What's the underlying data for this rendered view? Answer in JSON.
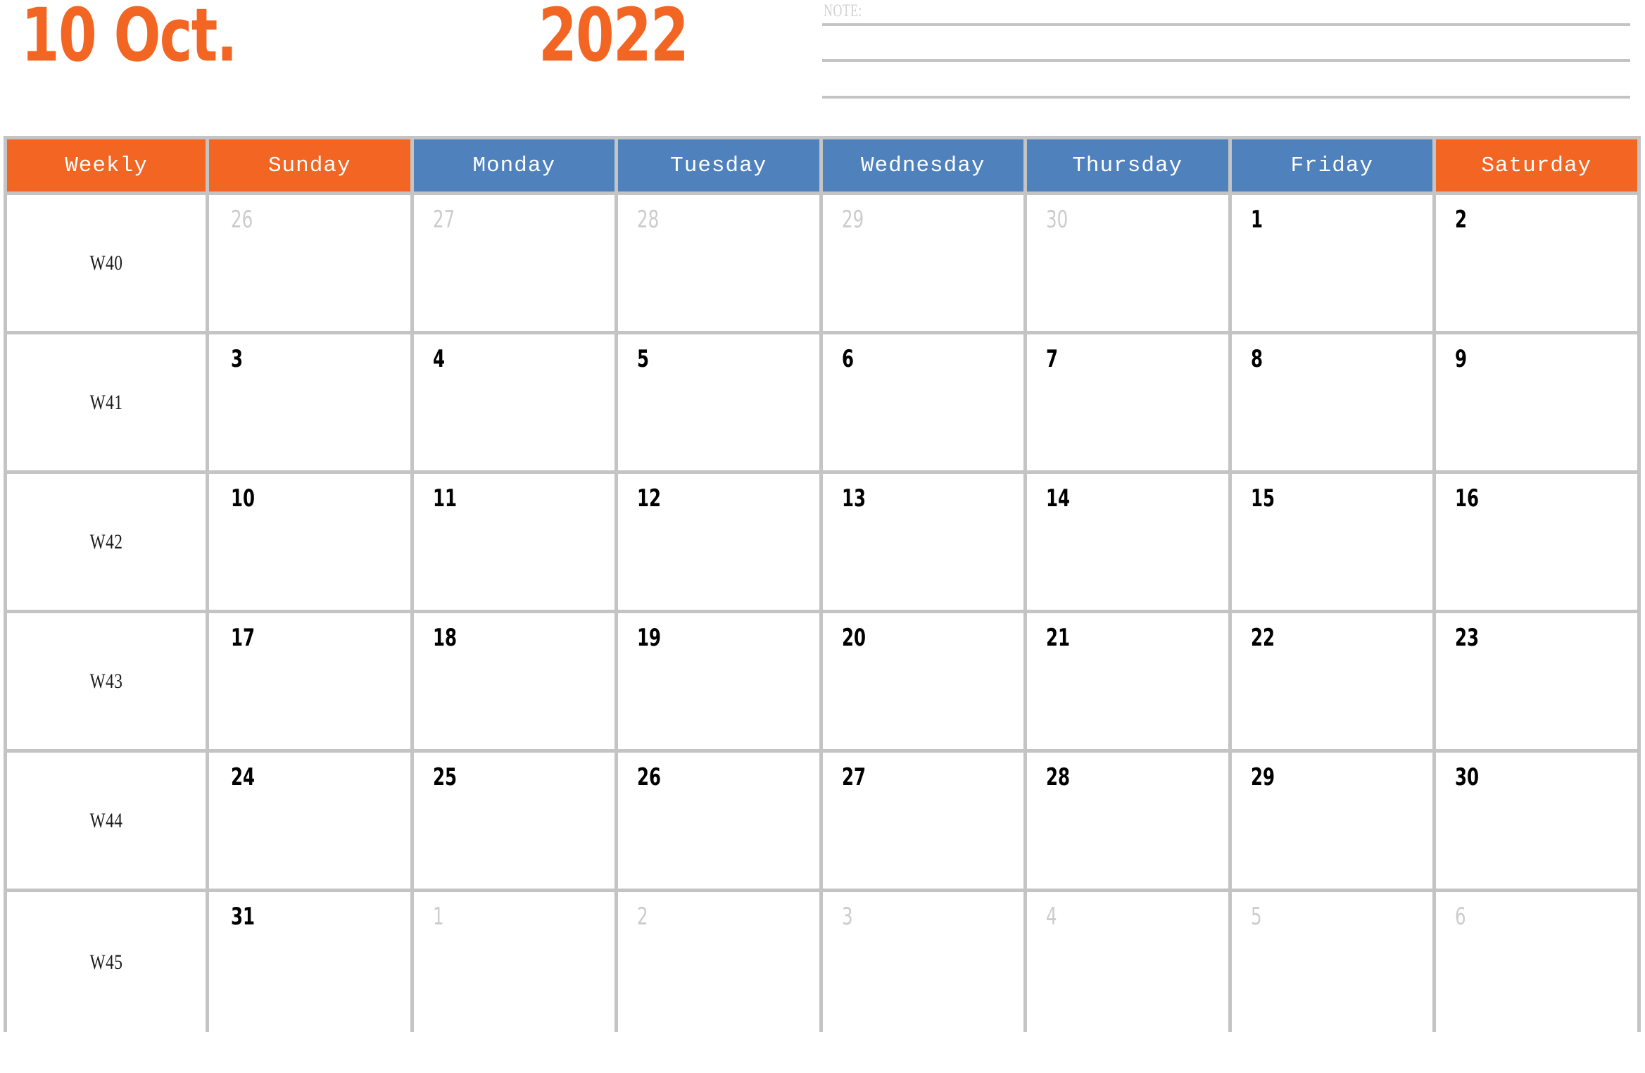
{
  "header": {
    "month_label": "10 Oct.",
    "year_label": "2022",
    "accent_orange": "#F26522",
    "accent_blue": "#4F81BD",
    "grid_line_color": "#C4C4C4",
    "muted_text_color": "#CCCCCC"
  },
  "note": {
    "label": "NOTE:",
    "lines": [
      "",
      "",
      ""
    ]
  },
  "calendar": {
    "columns": [
      {
        "label": "Weekly",
        "style": "orange"
      },
      {
        "label": "Sunday",
        "style": "orange"
      },
      {
        "label": "Monday",
        "style": "blue"
      },
      {
        "label": "Tuesday",
        "style": "blue"
      },
      {
        "label": "Wednesday",
        "style": "blue"
      },
      {
        "label": "Thursday",
        "style": "blue"
      },
      {
        "label": "Friday",
        "style": "blue"
      },
      {
        "label": "Saturday",
        "style": "orange"
      }
    ],
    "weeks": [
      {
        "week_label": "W40",
        "days": [
          {
            "num": "26",
            "muted": true
          },
          {
            "num": "27",
            "muted": true
          },
          {
            "num": "28",
            "muted": true
          },
          {
            "num": "29",
            "muted": true
          },
          {
            "num": "30",
            "muted": true
          },
          {
            "num": "1",
            "muted": false
          },
          {
            "num": "2",
            "muted": false
          }
        ]
      },
      {
        "week_label": "W41",
        "days": [
          {
            "num": "3",
            "muted": false
          },
          {
            "num": "4",
            "muted": false
          },
          {
            "num": "5",
            "muted": false
          },
          {
            "num": "6",
            "muted": false
          },
          {
            "num": "7",
            "muted": false
          },
          {
            "num": "8",
            "muted": false
          },
          {
            "num": "9",
            "muted": false
          }
        ]
      },
      {
        "week_label": "W42",
        "days": [
          {
            "num": "10",
            "muted": false
          },
          {
            "num": "11",
            "muted": false
          },
          {
            "num": "12",
            "muted": false
          },
          {
            "num": "13",
            "muted": false
          },
          {
            "num": "14",
            "muted": false
          },
          {
            "num": "15",
            "muted": false
          },
          {
            "num": "16",
            "muted": false
          }
        ]
      },
      {
        "week_label": "W43",
        "days": [
          {
            "num": "17",
            "muted": false
          },
          {
            "num": "18",
            "muted": false
          },
          {
            "num": "19",
            "muted": false
          },
          {
            "num": "20",
            "muted": false
          },
          {
            "num": "21",
            "muted": false
          },
          {
            "num": "22",
            "muted": false
          },
          {
            "num": "23",
            "muted": false
          }
        ]
      },
      {
        "week_label": "W44",
        "days": [
          {
            "num": "24",
            "muted": false
          },
          {
            "num": "25",
            "muted": false
          },
          {
            "num": "26",
            "muted": false
          },
          {
            "num": "27",
            "muted": false
          },
          {
            "num": "28",
            "muted": false
          },
          {
            "num": "29",
            "muted": false
          },
          {
            "num": "30",
            "muted": false
          }
        ]
      },
      {
        "week_label": "W45",
        "days": [
          {
            "num": "31",
            "muted": false
          },
          {
            "num": "1",
            "muted": true
          },
          {
            "num": "2",
            "muted": true
          },
          {
            "num": "3",
            "muted": true
          },
          {
            "num": "4",
            "muted": true
          },
          {
            "num": "5",
            "muted": true
          },
          {
            "num": "6",
            "muted": true
          }
        ]
      }
    ]
  }
}
